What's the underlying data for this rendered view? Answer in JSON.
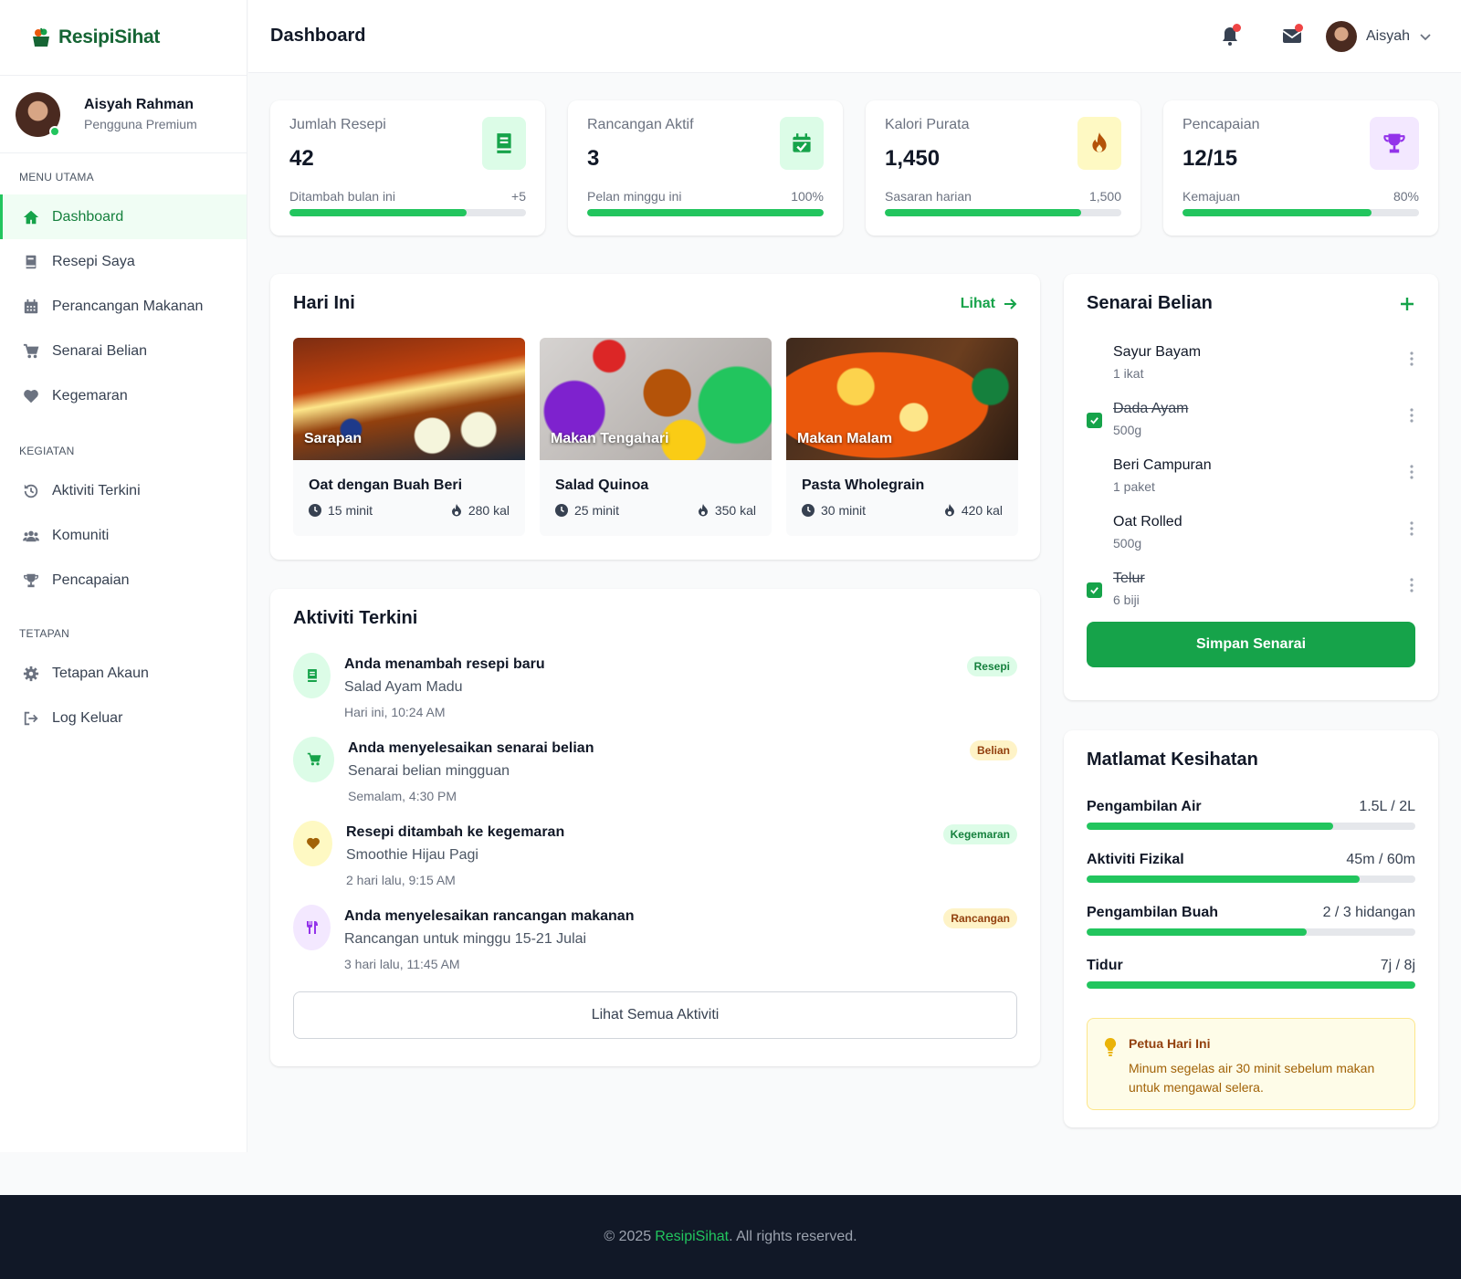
{
  "brand": {
    "name": "ResipiSihat"
  },
  "user": {
    "name": "Aisyah Rahman",
    "role": "Pengguna Premium",
    "short_name": "Aisyah"
  },
  "sidebar": {
    "sections": [
      {
        "title": "MENU UTAMA",
        "items": [
          {
            "label": "Dashboard",
            "icon": "home-icon",
            "active": true
          },
          {
            "label": "Resepi Saya",
            "icon": "book-icon"
          },
          {
            "label": "Perancangan Makanan",
            "icon": "calendar-icon"
          },
          {
            "label": "Senarai Belian",
            "icon": "cart-icon"
          },
          {
            "label": "Kegemaran",
            "icon": "heart-icon"
          }
        ]
      },
      {
        "title": "KEGIATAN",
        "items": [
          {
            "label": "Aktiviti Terkini",
            "icon": "history-icon"
          },
          {
            "label": "Komuniti",
            "icon": "users-icon"
          },
          {
            "label": "Pencapaian",
            "icon": "trophy-icon"
          }
        ]
      },
      {
        "title": "TETAPAN",
        "items": [
          {
            "label": "Tetapan Akaun",
            "icon": "gear-icon"
          },
          {
            "label": "Log Keluar",
            "icon": "logout-icon"
          }
        ]
      }
    ]
  },
  "header": {
    "title": "Dashboard"
  },
  "stats": [
    {
      "label": "Jumlah Resepi",
      "value": "42",
      "foot_label": "Ditambah bulan ini",
      "foot_value": "+5",
      "progress": 0.75,
      "icon": "book-icon",
      "icon_bg": "#dcfce7",
      "icon_color": "#16a34a"
    },
    {
      "label": "Rancangan Aktif",
      "value": "3",
      "foot_label": "Pelan minggu ini",
      "foot_value": "100%",
      "progress": 1.0,
      "icon": "calendar-check-icon",
      "icon_bg": "#dcfce7",
      "icon_color": "#16a34a"
    },
    {
      "label": "Kalori Purata",
      "value": "1,450",
      "foot_label": "Sasaran harian",
      "foot_value": "1,500",
      "progress": 0.83,
      "icon": "fire-icon",
      "icon_bg": "#fef9c3",
      "icon_color": "#b45309"
    },
    {
      "label": "Pencapaian",
      "value": "12/15",
      "foot_label": "Kemajuan",
      "foot_value": "80%",
      "progress": 0.8,
      "icon": "trophy-icon",
      "icon_bg": "#f3e8ff",
      "icon_color": "#9333ea"
    }
  ],
  "today": {
    "title": "Hari Ini",
    "link": "Lihat",
    "meals": [
      {
        "tag": "Sarapan",
        "name": "Oat dengan Buah Beri",
        "time": "15 minit",
        "kcal": "280 kal"
      },
      {
        "tag": "Makan Tengahari",
        "name": "Salad Quinoa",
        "time": "25 minit",
        "kcal": "350 kal"
      },
      {
        "tag": "Makan Malam",
        "name": "Pasta Wholegrain",
        "time": "30 minit",
        "kcal": "420 kal"
      }
    ]
  },
  "activity": {
    "title": "Aktiviti Terkini",
    "items": [
      {
        "title": "Anda menambah resepi baru",
        "sub": "Salad Ayam Madu",
        "time": "Hari ini, 10:24 AM",
        "badge": "Resepi"
      },
      {
        "title": "Anda menyelesaikan senarai belian",
        "sub": "Senarai belian mingguan",
        "time": "Semalam, 4:30 PM",
        "badge": "Belian"
      },
      {
        "title": "Resepi ditambah ke kegemaran",
        "sub": "Smoothie Hijau Pagi",
        "time": "2 hari lalu, 9:15 AM",
        "badge": "Kegemaran"
      },
      {
        "title": "Anda menyelesaikan rancangan makanan",
        "sub": "Rancangan untuk minggu 15-21 Julai",
        "time": "3 hari lalu, 11:45 AM",
        "badge": "Rancangan"
      }
    ],
    "view_all": "Lihat Semua Aktiviti"
  },
  "shopping": {
    "title": "Senarai Belian",
    "items": [
      {
        "name": "Sayur Bayam",
        "qty": "1 ikat",
        "checked": false
      },
      {
        "name": "Dada Ayam",
        "qty": "500g",
        "checked": true
      },
      {
        "name": "Beri Campuran",
        "qty": "1 paket",
        "checked": false
      },
      {
        "name": "Oat Rolled",
        "qty": "500g",
        "checked": false
      },
      {
        "name": "Telur",
        "qty": "6 biji",
        "checked": true
      }
    ],
    "save": "Simpan Senarai"
  },
  "goals": {
    "title": "Matlamat Kesihatan",
    "items": [
      {
        "label": "Pengambilan Air",
        "value": "1.5L / 2L",
        "progress": 0.75
      },
      {
        "label": "Aktiviti Fizikal",
        "value": "45m / 60m",
        "progress": 0.83
      },
      {
        "label": "Pengambilan Buah",
        "value": "2 / 3 hidangan",
        "progress": 0.67
      },
      {
        "label": "Tidur",
        "value": "7j / 8j",
        "progress": 1.0
      }
    ],
    "tip_title": "Petua Hari Ini",
    "tip_text": "Minum segelas air 30 minit sebelum makan untuk mengawal selera."
  },
  "footer": {
    "prefix": "© 2025",
    "brand": "ResipiSihat",
    "suffix": ". All rights reserved."
  },
  "colors": {
    "accent": "#16a34a",
    "accent_light": "#22c55e",
    "footer_bg": "#111827"
  }
}
